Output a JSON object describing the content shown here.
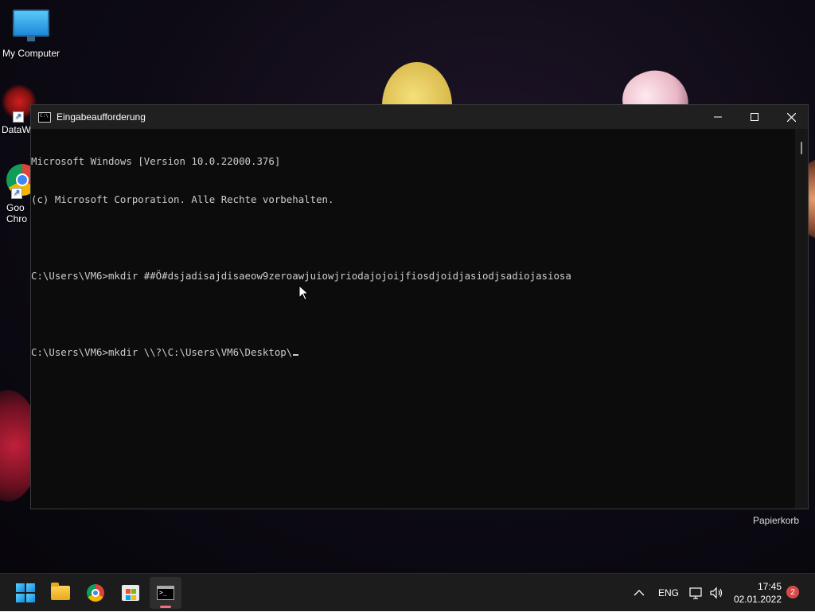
{
  "desktop": {
    "icons": [
      {
        "label": "My Computer"
      },
      {
        "label": "DataW"
      },
      {
        "label": "Goo Chro"
      }
    ],
    "recycle_bin": "Papierkorb"
  },
  "cmd_window": {
    "title": "Eingabeaufforderung",
    "lines": [
      "Microsoft Windows [Version 10.0.22000.376]",
      "(c) Microsoft Corporation. Alle Rechte vorbehalten.",
      "",
      "C:\\Users\\VM6>mkdir ##Ö#dsjadisajdisaeow9zeroawjuiowjriodajojoijfiosdjoidjasiodjsadiojasiosa",
      "",
      "C:\\Users\\VM6>mkdir \\\\?\\C:\\Users\\VM6\\Desktop\\"
    ]
  },
  "taskbar": {
    "apps": [
      {
        "icon": "windows-start-icon"
      },
      {
        "icon": "file-explorer-icon"
      },
      {
        "icon": "chrome-icon"
      },
      {
        "icon": "microsoft-store-icon"
      },
      {
        "icon": "command-prompt-icon",
        "active": true
      }
    ],
    "tray": {
      "language": "ENG",
      "time": "17:45",
      "date": "02.01.2022",
      "notification_count": "2"
    }
  },
  "colors": {
    "console_bg": "#0c0c0c",
    "console_text": "#cccccc",
    "titlebar_bg": "#202020",
    "taskbar_bg": "#1c1c1c",
    "active_indicator": "#f07080",
    "badge": "#d84a4a"
  }
}
